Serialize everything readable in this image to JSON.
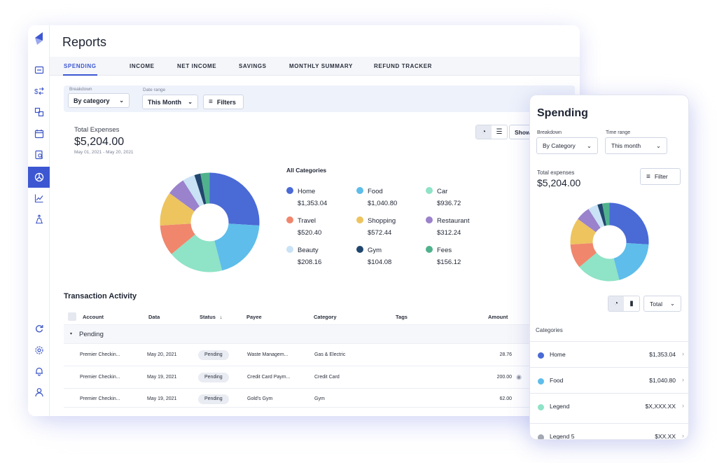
{
  "app": {
    "title": "Reports"
  },
  "tabs": [
    "SPENDING",
    "INCOME",
    "NET INCOME",
    "SAVINGS",
    "MONTHLY SUMMARY",
    "REFUND TRACKER"
  ],
  "filters": {
    "breakdown_label": "Breakdown",
    "breakdown_value": "By category",
    "daterange_label": "Date range",
    "daterange_value": "This Month",
    "filters_button": "Filters"
  },
  "summary": {
    "label": "Total Expenses",
    "value": "$5,204.00",
    "dates": "May 01, 2021 - May 20, 2021",
    "show_button": "Show"
  },
  "legend": {
    "title": "All Categories",
    "items": [
      {
        "name": "Home",
        "amount": "$1,353.04",
        "color": "#4a6ad6"
      },
      {
        "name": "Food",
        "amount": "$1,040.80",
        "color": "#5ebdea"
      },
      {
        "name": "Car",
        "amount": "$936.72",
        "color": "#8fe3c6"
      },
      {
        "name": "Travel",
        "amount": "$520.40",
        "color": "#f0866c"
      },
      {
        "name": "Shopping",
        "amount": "$572.44",
        "color": "#edc45e"
      },
      {
        "name": "Restaurant",
        "amount": "$312.24",
        "color": "#9a82cc"
      },
      {
        "name": "Beauty",
        "amount": "$208.16",
        "color": "#c9e2f5"
      },
      {
        "name": "Gym",
        "amount": "$104.08",
        "color": "#21466e"
      },
      {
        "name": "Fees",
        "amount": "$156.12",
        "color": "#4fb28d"
      }
    ]
  },
  "chart_data": [
    {
      "type": "pie",
      "title": "All Categories",
      "categories": [
        "Home",
        "Food",
        "Car",
        "Travel",
        "Shopping",
        "Restaurant",
        "Beauty",
        "Gym",
        "Fees"
      ],
      "values": [
        1353.04,
        1040.8,
        936.72,
        520.4,
        572.44,
        312.24,
        208.16,
        104.08,
        156.12
      ],
      "colors": [
        "#4a6ad6",
        "#5ebdea",
        "#8fe3c6",
        "#f0866c",
        "#edc45e",
        "#9a82cc",
        "#c9e2f5",
        "#21466e",
        "#4fb28d"
      ],
      "donut": true,
      "legend": "right"
    }
  ],
  "transactions": {
    "title": "Transaction Activity",
    "columns": [
      "Account",
      "Data",
      "Status",
      "Payee",
      "Category",
      "Tags",
      "Amount"
    ],
    "group": "Pending",
    "rows": [
      {
        "account": "Premier Checkin...",
        "date": "May 20, 2021",
        "status": "Pending",
        "payee": "Waste Managem...",
        "category": "Gas & Electric",
        "amount": "28.76"
      },
      {
        "account": "Premier Checkin...",
        "date": "May 19, 2021",
        "status": "Pending",
        "payee": "Credit Card Paym...",
        "category": "Credit Card",
        "amount": "200.00"
      },
      {
        "account": "Premier Checkin...",
        "date": "May 19, 2021",
        "status": "Pending",
        "payee": "Gold's Gym",
        "category": "Gym",
        "amount": "62.00"
      }
    ]
  },
  "mobile": {
    "title": "Spending",
    "breakdown_label": "Breakdown",
    "breakdown_value": "By Category",
    "timerange_label": "Time range",
    "timerange_value": "This month",
    "total_label": "Total expenses",
    "total_value": "$5,204.00",
    "filter_button": "Filter",
    "total_select": "Total",
    "categories_label": "Categories",
    "items": [
      {
        "name": "Home",
        "value": "$1,353.04",
        "color": "#4a6ad6"
      },
      {
        "name": "Food",
        "value": "$1,040.80",
        "color": "#5ebdea"
      },
      {
        "name": "Legend",
        "value": "$X,XXX.XX",
        "color": "#8fe3c6"
      },
      {
        "name": "Legend 5",
        "value": "$XX.XX",
        "color": "#a3a8b3"
      }
    ]
  },
  "icons": [
    "logo",
    "dashboard-icon",
    "transfer-icon",
    "accounts-icon",
    "calendar-icon",
    "reports-doc-icon",
    "reports-active-icon",
    "trends-icon",
    "investments-icon",
    "refresh-icon",
    "settings-icon",
    "notifications-icon",
    "profile-icon",
    "filter-icon",
    "pie-toggle-icon",
    "bar-toggle-icon",
    "visibility-icon"
  ]
}
